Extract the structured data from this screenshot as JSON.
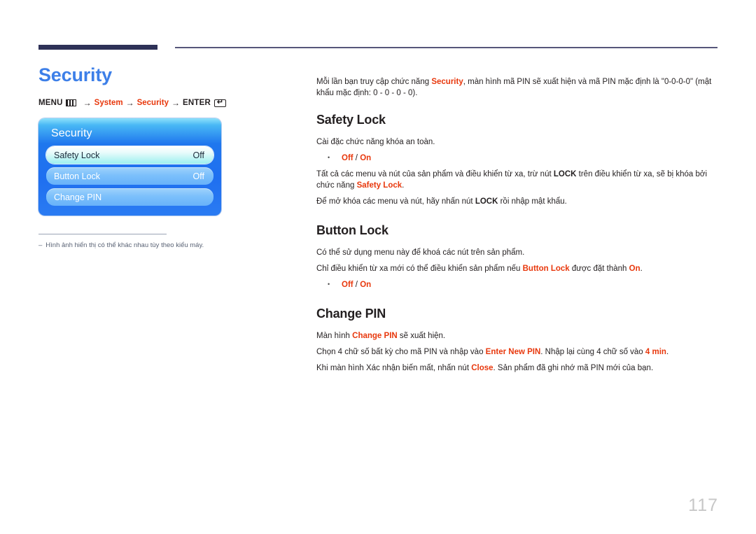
{
  "page": {
    "title": "Security",
    "number": "117"
  },
  "breadcrumb": {
    "menu_label": "MENU",
    "menu_icon": "menu-bars-icon",
    "arrow": "→",
    "item1": "System",
    "item2": "Security",
    "enter_label": "ENTER",
    "enter_icon": "enter-return-icon",
    "enter_glyph": "↵"
  },
  "osd": {
    "title": "Security",
    "rows": [
      {
        "label": "Safety Lock",
        "value": "Off",
        "selected": true
      },
      {
        "label": "Button Lock",
        "value": "Off",
        "selected": false
      },
      {
        "label": "Change PIN",
        "value": "",
        "selected": false
      }
    ]
  },
  "footnote": {
    "dash": "‒",
    "text": "Hình ảnh hiển thị có thể khác nhau tùy theo kiểu máy."
  },
  "intro": {
    "part1": "Mỗi lần bạn truy cập chức năng ",
    "highlight": "Security",
    "part2": ", màn hình mã PIN sẽ xuất hiện và mã PIN mặc định là \"0-0-0-0\" (mật khẩu mặc định: 0 - 0 - 0 - 0)."
  },
  "sections": [
    {
      "title": "Safety Lock",
      "line1": "Cài đặc chức năng khóa an toàn.",
      "option_off": "Off",
      "option_sep": " / ",
      "option_on": "On",
      "line2_a": "Tất cả các menu và nút của sản phẩm và điều khiển từ xa, trừ nút ",
      "line2_b": "LOCK",
      "line2_c": " trên điều khiển từ xa, sẽ bị khóa bởi chức năng ",
      "line2_d": "Safety Lock",
      "line2_e": ".",
      "line3_a": "Để mở khóa các menu và nút, hãy nhấn nút ",
      "line3_b": "LOCK",
      "line3_c": " rồi nhập mật khẩu."
    },
    {
      "title": "Button Lock",
      "line1": "Có thể sử dụng menu này để khoá các nút trên sản phẩm.",
      "line2_a": "Chỉ điều khiển từ xa mới có thể điều khiển sản phẩm nếu ",
      "line2_b": "Button Lock",
      "line2_c": " được đặt thành ",
      "line2_d": "On",
      "line2_e": ".",
      "option_off": "Off",
      "option_sep": " / ",
      "option_on": "On"
    },
    {
      "title": "Change PIN",
      "line1_a": "Màn hình ",
      "line1_b": "Change PIN",
      "line1_c": " sẽ xuất hiện.",
      "line2_a": "Chọn 4 chữ số bất kỳ cho mã PIN và nhập vào ",
      "line2_b": "Enter New PIN",
      "line2_c": ". Nhập lại cùng 4 chữ số vào ",
      "line2_d": "4 min",
      "line2_e": ".",
      "line3_a": "Khi màn hình Xác nhận biến mất, nhấn nút ",
      "line3_b": "Close",
      "line3_c": ". Sản phẩm đã ghi nhớ mã PIN mới của bạn."
    }
  ],
  "colors": {
    "accent_blue": "#3d7fe8",
    "accent_red": "#e8380d",
    "rule_navy": "#2e3157",
    "osd_blue": "#1f77ee"
  }
}
